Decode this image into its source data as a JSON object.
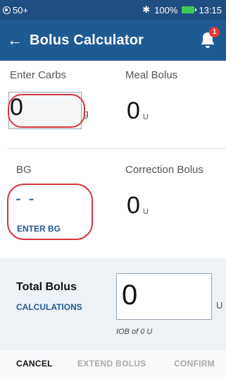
{
  "status_bar": {
    "left_text": "50+",
    "battery_percent": "100%",
    "time": "13:15",
    "bluetooth_glyph": "✱"
  },
  "header": {
    "title": "Bolus Calculator",
    "back_glyph": "←",
    "notification_count": "1"
  },
  "carbs": {
    "label": "Enter Carbs",
    "value": "0",
    "unit": "g"
  },
  "meal_bolus": {
    "label": "Meal Bolus",
    "value": "0",
    "unit": "U"
  },
  "bg": {
    "label": "BG",
    "value": "- -",
    "enter_link": "ENTER BG"
  },
  "correction_bolus": {
    "label": "Correction Bolus",
    "value": "0",
    "unit": "U"
  },
  "total_bolus": {
    "title": "Total Bolus",
    "calculations_link": "CALCULATIONS",
    "value": "0",
    "unit": "U",
    "iob_text": "IOB of 0 U"
  },
  "footer": {
    "cancel": "CANCEL",
    "extend": "EXTEND BOLUS",
    "confirm": "CONFIRM"
  },
  "colors": {
    "header_bg": "#1f5b93",
    "accent_link": "#1f5b93",
    "annotation_red": "#d9363e",
    "badge_red": "#e53935",
    "battery_green": "#3ecb54"
  }
}
